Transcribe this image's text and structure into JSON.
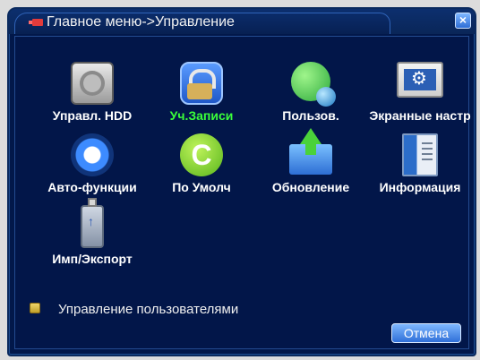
{
  "window": {
    "title": "Главное меню->Управление",
    "close_symbol": "×",
    "icon": "menu-icon"
  },
  "menu": {
    "items": [
      {
        "label": "Управл. HDD",
        "icon": "hdd-icon",
        "selected": false
      },
      {
        "label": "Уч.Записи",
        "icon": "account-lock-icon",
        "selected": true
      },
      {
        "label": "Пользов.",
        "icon": "users-icon",
        "selected": false
      },
      {
        "label": "Экранные настр",
        "icon": "display-settings-icon",
        "selected": false
      },
      {
        "label": "Авто-функции",
        "icon": "auto-functions-icon",
        "selected": false
      },
      {
        "label": "По Умолч",
        "icon": "default-reset-icon",
        "selected": false
      },
      {
        "label": "Обновление",
        "icon": "update-icon",
        "selected": false
      },
      {
        "label": "Информация",
        "icon": "information-icon",
        "selected": false
      },
      {
        "label": "Имп/Экспорт",
        "icon": "usb-import-export-icon",
        "selected": false
      }
    ]
  },
  "status": {
    "text": "Управление пользователями",
    "icon": "user-management-icon"
  },
  "buttons": {
    "cancel_label": "Отмена"
  },
  "colors": {
    "background": "#021649",
    "accent": "#2f6fd8",
    "selected_label": "#3aff3a"
  }
}
